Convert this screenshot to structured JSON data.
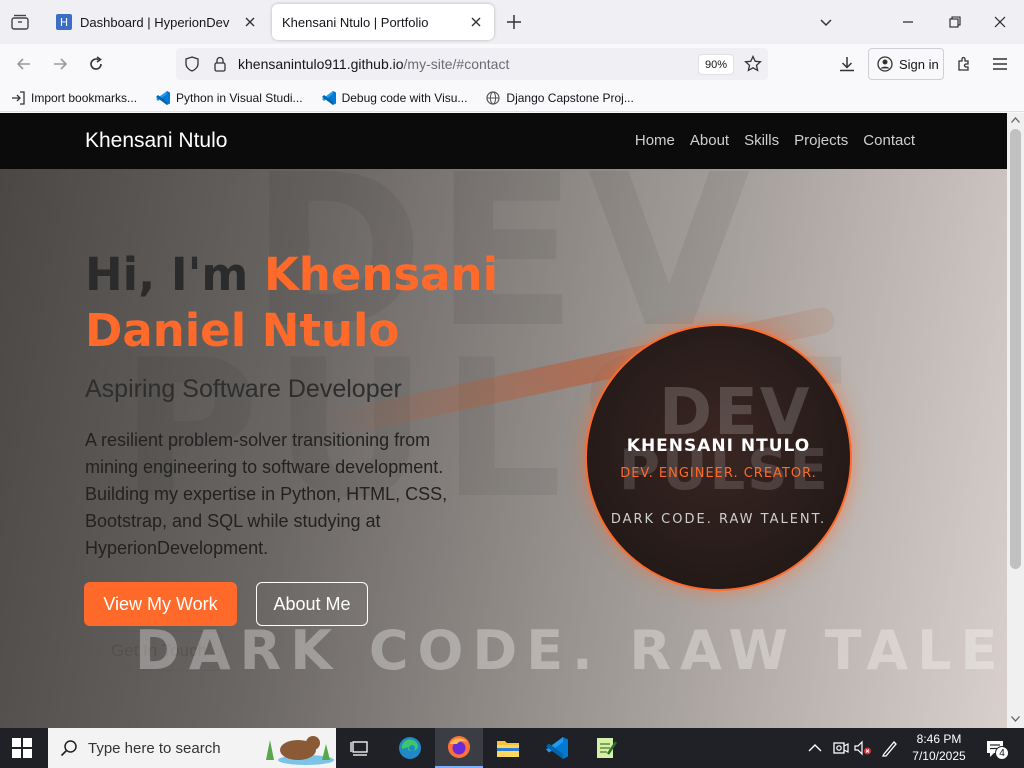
{
  "browser": {
    "tabs": [
      {
        "title": "Dashboard | HyperionDev",
        "active": false
      },
      {
        "title": "Khensani Ntulo | Portfolio",
        "active": true
      }
    ],
    "url": {
      "host": "khensanintulo911.github.io",
      "path": "/my-site/#contact"
    },
    "zoom": "90%",
    "sign_in_label": "Sign in",
    "bookmarks": [
      {
        "label": "Import bookmarks...",
        "icon": "import-icon"
      },
      {
        "label": "Python in Visual Studi...",
        "icon": "vscode-icon"
      },
      {
        "label": "Debug code with Visu...",
        "icon": "vscode-icon"
      },
      {
        "label": "Django Capstone Proj...",
        "icon": "globe-icon"
      }
    ]
  },
  "site": {
    "brand": "Khensani Ntulo",
    "nav": [
      "Home",
      "About",
      "Skills",
      "Projects",
      "Contact"
    ],
    "hero": {
      "greeting": "Hi, I'm ",
      "name_line1": "Khensani",
      "name_line2": "Daniel Ntulo",
      "subtitle": "Aspiring Software Developer",
      "description": "A resilient problem-solver transitioning from mining engineering to software development. Building my expertise in Python, HTML, CSS, Bootstrap, and SQL while studying at HyperionDevelopment.",
      "buttons": {
        "primary": "View My Work",
        "secondary": "About Me",
        "tertiary": "Get In Touch"
      },
      "background_text": {
        "dev": "DEV",
        "pulse": "PULSE",
        "tagline": "DARK CODE. RAW TALENT."
      }
    },
    "badge": {
      "dev": "DEV",
      "pulse": "PULSE",
      "name": "KHENSANI NTULO",
      "role": "DEV. ENGINEER. CREATOR.",
      "tagline": "DARK CODE. RAW TALENT."
    },
    "colors": {
      "accent": "#ff6a2b",
      "nav_bg": "#0b0b0b"
    }
  },
  "taskbar": {
    "search_placeholder": "Type here to search",
    "time": "8:46 PM",
    "date": "7/10/2025",
    "notification_count": "4",
    "apps": [
      "task-view-icon",
      "edge-icon",
      "firefox-icon",
      "file-explorer-icon",
      "vscode-icon",
      "notepad-icon"
    ]
  }
}
